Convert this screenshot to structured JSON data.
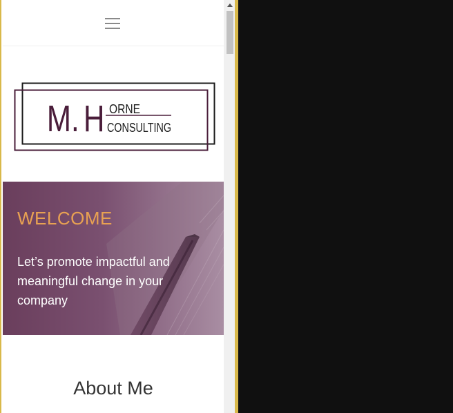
{
  "navbar": {
    "menu_icon": "hamburger-menu-icon"
  },
  "logo": {
    "initials_m": "M.",
    "initials_h": "H",
    "word_top": "ORNE",
    "word_bottom": "CONSULTING",
    "colors": {
      "primary": "#4a1d3a",
      "frame_dark": "#1b1b1b"
    }
  },
  "hero": {
    "title": "WELCOME",
    "text": "Let’s promote impactful and meaningful change in your company",
    "colors": {
      "title": "#e8a152",
      "text": "#ffffff",
      "overlay": "#6a3e5c"
    }
  },
  "about": {
    "title": "About Me"
  },
  "scrollbar": {
    "up_icon": "scroll-up-arrow-icon"
  },
  "colors": {
    "window_border": "#d9b94a",
    "background_dark": "#101010"
  }
}
